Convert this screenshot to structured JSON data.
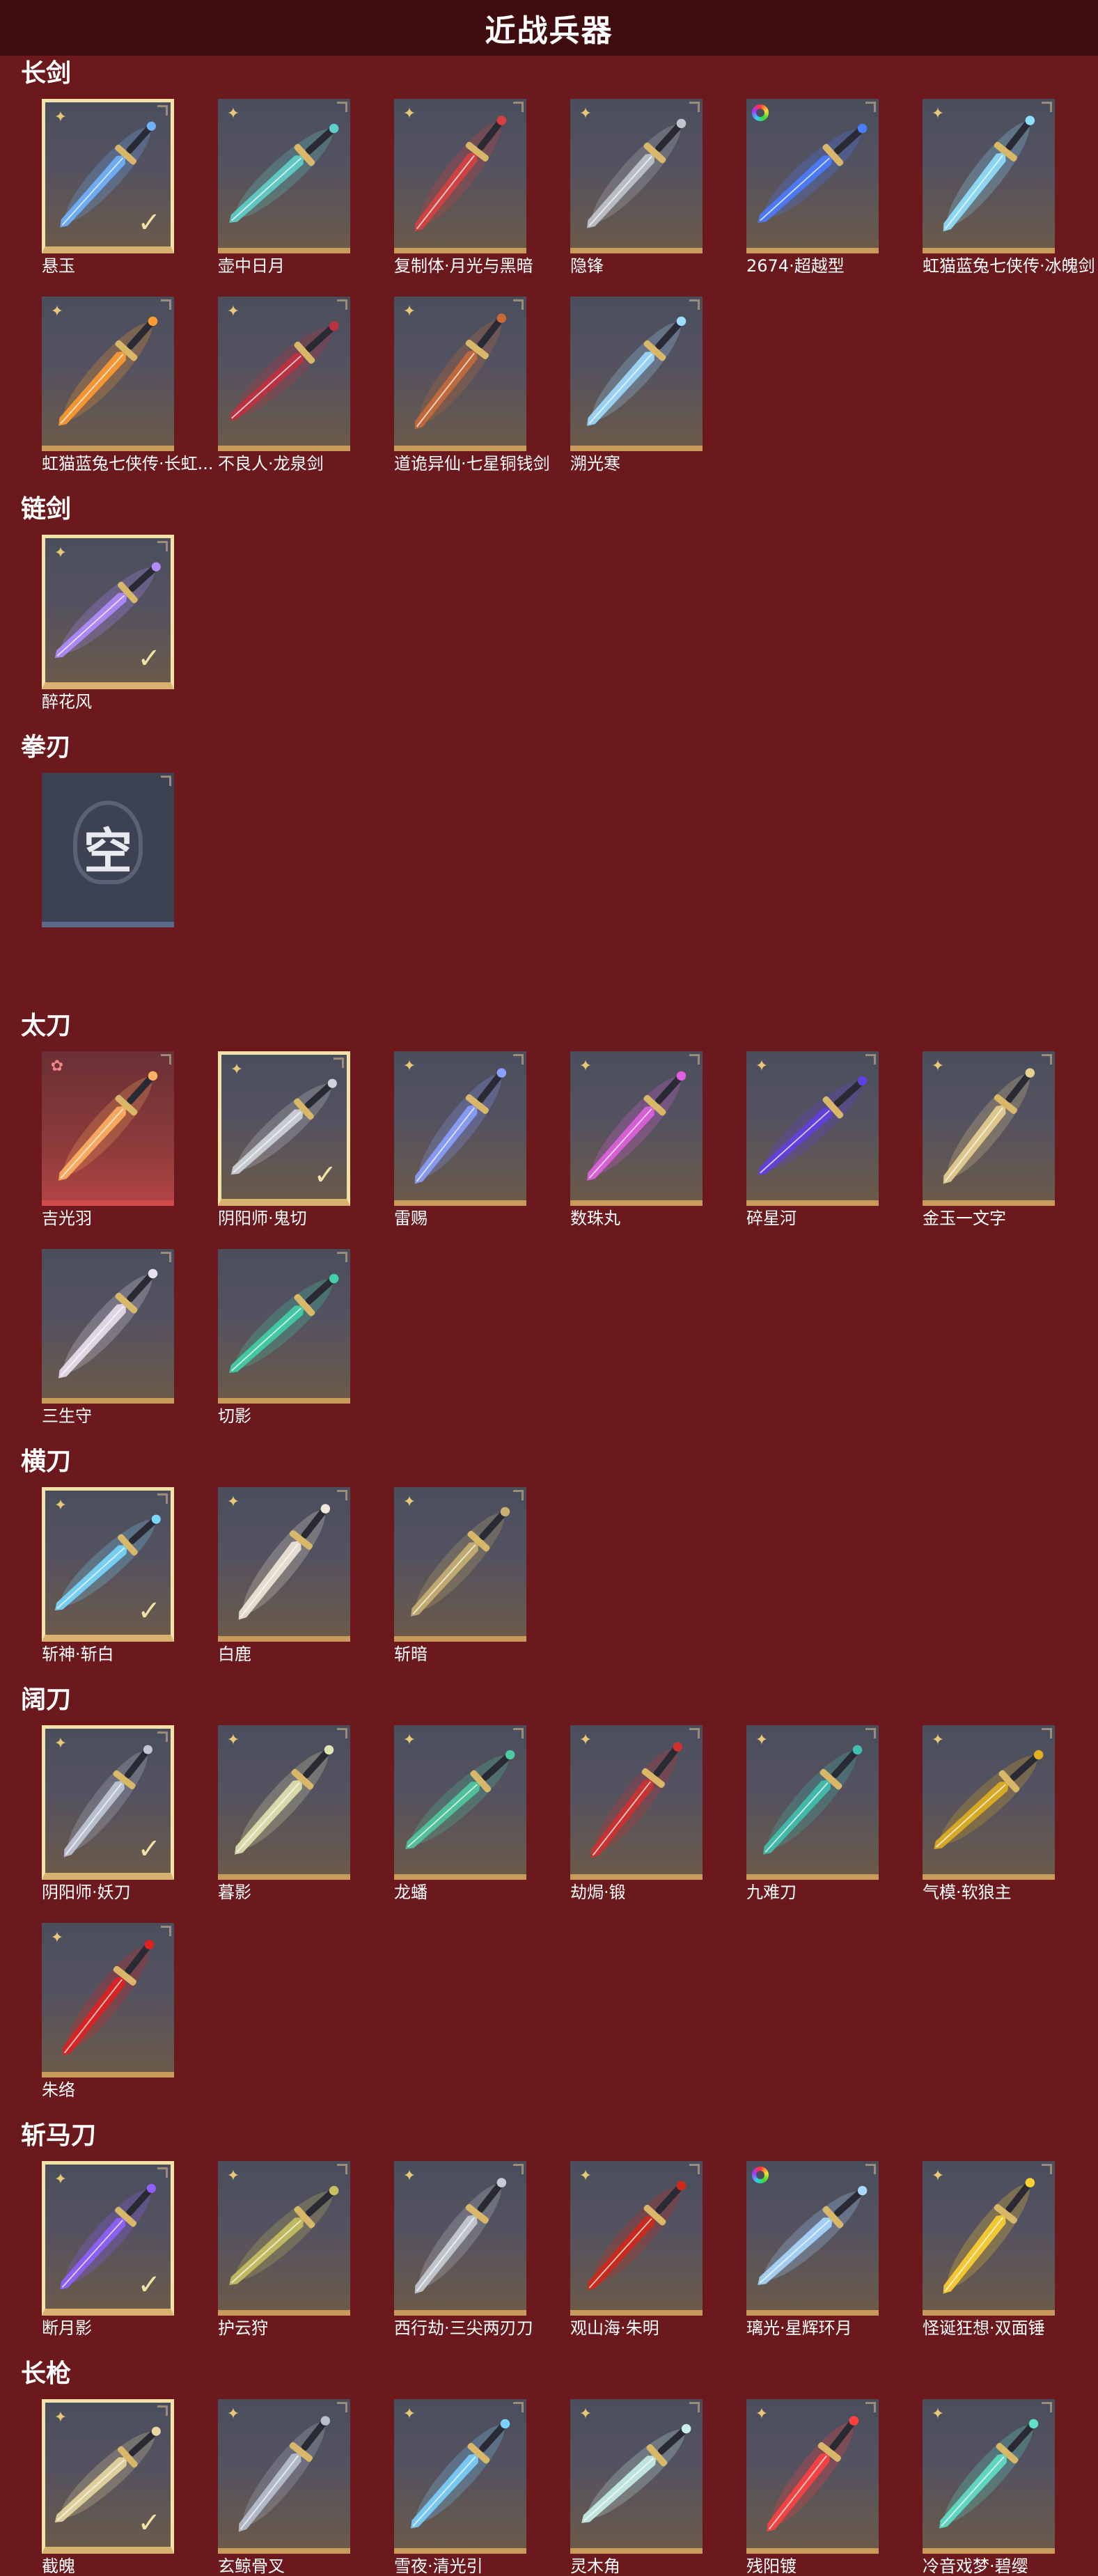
{
  "page_title": "近战兵器",
  "colors": {
    "background": "#6b191c",
    "header": "#3f0d10",
    "card_border": "#c89a5c",
    "selected_border": "#f2e2a8"
  },
  "sections": [
    {
      "title": "长剑",
      "items": [
        {
          "name": "悬玉",
          "badge": "star-icon",
          "selected": true,
          "hue": "#6fb3ff"
        },
        {
          "name": "壶中日月",
          "badge": "star-icon",
          "hue": "#5fd0c8"
        },
        {
          "name": "复制体·月光与黑暗",
          "badge": "star-icon",
          "hue": "#d84040"
        },
        {
          "name": "隐锋",
          "badge": "star-icon",
          "hue": "#c0c4cc"
        },
        {
          "name": "2674·超越型",
          "badge": "rainbow-ring-icon",
          "hue": "#4a7cff"
        },
        {
          "name": "虹猫蓝兔七侠传·冰魄剑",
          "badge": "star-icon",
          "hue": "#8fe0ff"
        },
        {
          "name": "虹猫蓝兔七侠传·长虹剑",
          "display": "虹猫蓝兔七侠传·长虹...",
          "badge": "star-icon",
          "hue": "#ff9a30"
        },
        {
          "name": "不良人·龙泉剑",
          "badge": "star-icon",
          "hue": "#c03040"
        },
        {
          "name": "道诡异仙·七星铜钱剑",
          "badge": "star-icon",
          "hue": "#c86a38"
        },
        {
          "name": "溯光寒",
          "badge": "",
          "hue": "#9fdcff"
        }
      ]
    },
    {
      "title": "链剑",
      "items": [
        {
          "name": "醉花风",
          "badge": "star-icon",
          "selected": true,
          "hue": "#b08cff"
        }
      ]
    },
    {
      "title": "拳刃",
      "items": [
        {
          "name": "",
          "empty": true,
          "empty_glyph": "空"
        }
      ]
    },
    {
      "title": "太刀",
      "items": [
        {
          "name": "吉光羽",
          "badge": "flower-icon",
          "legend": true,
          "hue": "#ffb060"
        },
        {
          "name": "阴阳师·鬼切",
          "badge": "star-icon",
          "selected": true,
          "hue": "#d0d4dc"
        },
        {
          "name": "雷赐",
          "badge": "star-icon",
          "hue": "#8aa0ff"
        },
        {
          "name": "数珠丸",
          "badge": "star-icon",
          "hue": "#e060e0"
        },
        {
          "name": "碎星河",
          "badge": "star-icon",
          "hue": "#6040e0"
        },
        {
          "name": "金玉一文字",
          "badge": "star-icon",
          "hue": "#e8d090"
        },
        {
          "name": "三生守",
          "badge": "",
          "hue": "#e8e0f0"
        },
        {
          "name": "切影",
          "badge": "",
          "hue": "#40d0a8"
        }
      ]
    },
    {
      "title": "横刀",
      "items": [
        {
          "name": "斩神·斩白",
          "badge": "star-icon",
          "selected": true,
          "hue": "#7ad8ff"
        },
        {
          "name": "白鹿",
          "badge": "star-icon",
          "hue": "#f0e8d8"
        },
        {
          "name": "斩暗",
          "badge": "star-icon",
          "hue": "#c8b070"
        }
      ]
    },
    {
      "title": "阔刀",
      "items": [
        {
          "name": "阴阳师·妖刀",
          "badge": "star-icon",
          "selected": true,
          "hue": "#c0c8d8"
        },
        {
          "name": "暮影",
          "badge": "star-icon",
          "hue": "#e0e4b0"
        },
        {
          "name": "龙蟠",
          "badge": "star-icon",
          "hue": "#50c8a0"
        },
        {
          "name": "劫焗·锻",
          "badge": "star-icon",
          "hue": "#d03030"
        },
        {
          "name": "九难刀",
          "badge": "star-icon",
          "hue": "#40c0b0"
        },
        {
          "name": "气模·软狼主",
          "badge": "star-icon",
          "hue": "#e0b020"
        },
        {
          "name": "朱络",
          "badge": "star-icon",
          "hue": "#e02020"
        }
      ]
    },
    {
      "title": "斩马刀",
      "items": [
        {
          "name": "断月影",
          "badge": "star-icon",
          "selected": true,
          "hue": "#9060ff"
        },
        {
          "name": "护云狩",
          "badge": "star-icon",
          "hue": "#c8c060"
        },
        {
          "name": "西行劫·三尖两刃刀",
          "badge": "star-icon",
          "hue": "#c8ccd4"
        },
        {
          "name": "观山海·朱明",
          "badge": "star-icon",
          "hue": "#d02818"
        },
        {
          "name": "璃光·星辉环月",
          "badge": "rainbow-ring-icon",
          "hue": "#a8d8ff"
        },
        {
          "name": "怪诞狂想·双面锤",
          "display": "怪诞狂想·双面锤",
          "badge": "star-icon",
          "hue": "#ffd030"
        }
      ]
    },
    {
      "title": "长枪",
      "items": [
        {
          "name": "截魄",
          "badge": "star-icon",
          "selected": true,
          "hue": "#e8d8a0"
        },
        {
          "name": "玄鲸骨叉",
          "badge": "star-icon",
          "hue": "#b8c0d0"
        },
        {
          "name": "雪夜·清光引",
          "badge": "star-icon",
          "hue": "#7ad0ff"
        },
        {
          "name": "灵木角",
          "badge": "star-icon",
          "hue": "#c8f0e8"
        },
        {
          "name": "残阳镀",
          "badge": "star-icon",
          "hue": "#ff4040"
        },
        {
          "name": "冷音戏梦·碧缨",
          "badge": "star-icon",
          "hue": "#60e0c8"
        }
      ]
    }
  ]
}
